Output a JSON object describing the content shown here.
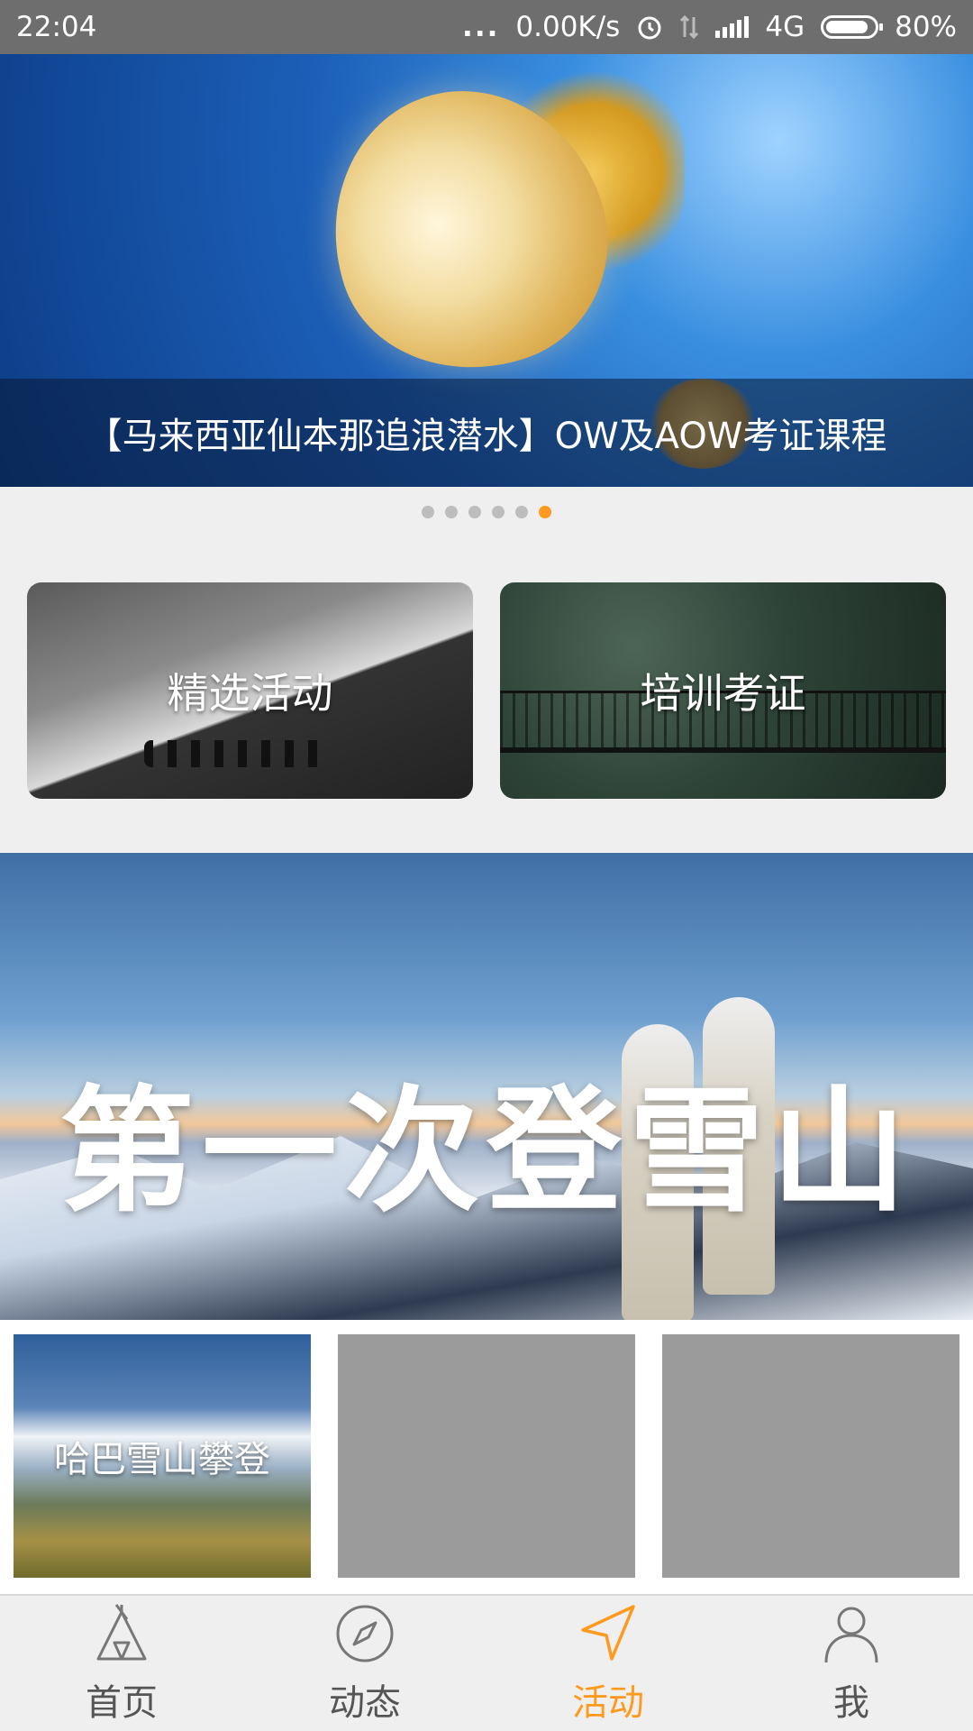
{
  "status_bar": {
    "time": "22:04",
    "dots": "...",
    "net_speed": "0.00K/s",
    "network": "4G",
    "battery": "80%",
    "icons": [
      "alarm-icon",
      "data-transfer-icon",
      "signal-icon",
      "battery-icon"
    ]
  },
  "banner": {
    "caption": "【马来西亚仙本那追浪潜水】OW及AOW考证课程",
    "slide_count": 6,
    "active_slide": 6
  },
  "categories": [
    {
      "label": "精选活动"
    },
    {
      "label": "培训考证"
    }
  ],
  "feature": {
    "title": "第一次登雪山"
  },
  "thumbnails": [
    {
      "label": "哈巴雪山攀登"
    },
    {
      "label": ""
    },
    {
      "label": ""
    }
  ],
  "nav": {
    "items": [
      {
        "label": "首页",
        "icon": "tent-icon"
      },
      {
        "label": "动态",
        "icon": "compass-icon"
      },
      {
        "label": "活动",
        "icon": "paper-plane-icon"
      },
      {
        "label": "我",
        "icon": "user-icon"
      }
    ],
    "active_index": 2
  },
  "colors": {
    "accent": "#ff9a1f",
    "status_bar": "#6e6e6e",
    "background": "#efefef",
    "placeholder": "#9b9b9b"
  }
}
